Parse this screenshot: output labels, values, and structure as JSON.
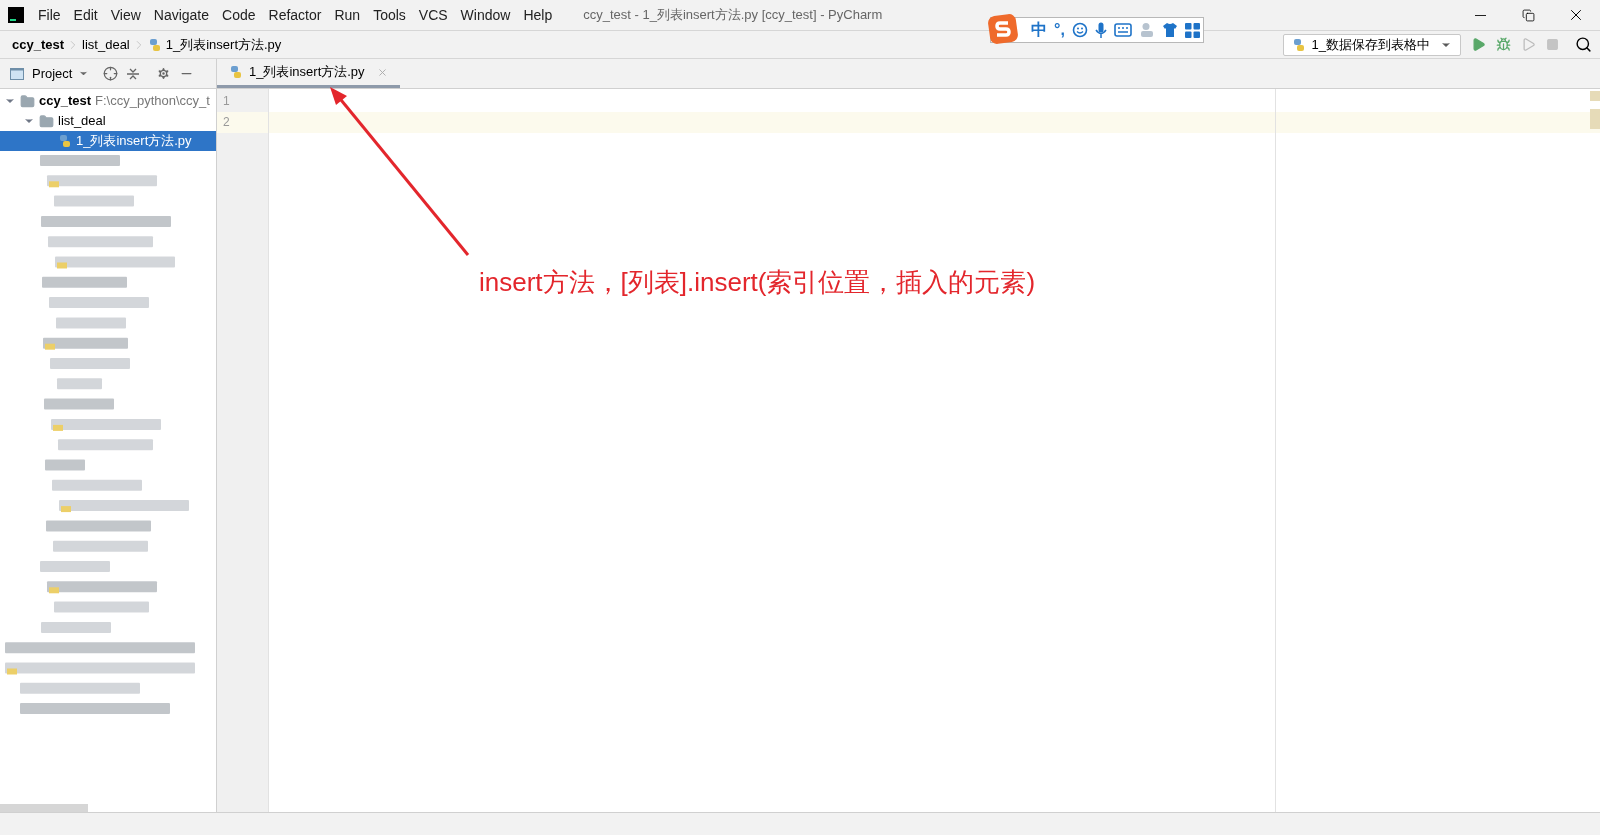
{
  "window": {
    "title": "ccy_test - 1_列表insert方法.py [ccy_test] - PyCharm"
  },
  "menu": [
    "File",
    "Edit",
    "View",
    "Navigate",
    "Code",
    "Refactor",
    "Run",
    "Tools",
    "VCS",
    "Window",
    "Help"
  ],
  "breadcrumbs": [
    "ccy_test",
    "list_deal",
    "1_列表insert方法.py"
  ],
  "ime_toolbar": {
    "mode": "中",
    "punctuation": "°,"
  },
  "run_config": {
    "label": "1_数据保存到表格中"
  },
  "project_panel": {
    "title": "Project"
  },
  "tabs": [
    {
      "label": "1_列表insert方法.py",
      "selected": true
    }
  ],
  "tree": [
    {
      "label": "ccy_test",
      "path": "F:\\ccy_python\\ccy_t",
      "expanded": true,
      "selected": false,
      "children": [
        {
          "label": "list_deal",
          "expanded": true,
          "selected": false,
          "children": [
            {
              "label": "1_列表insert方法.py",
              "selected": true
            }
          ]
        }
      ]
    }
  ],
  "editor": {
    "lines": [
      {
        "number": "1",
        "current": false
      },
      {
        "number": "2",
        "current": true
      }
    ]
  },
  "annotation": {
    "text": "insert方法，[列表].insert(索引位置，插入的元素)"
  }
}
